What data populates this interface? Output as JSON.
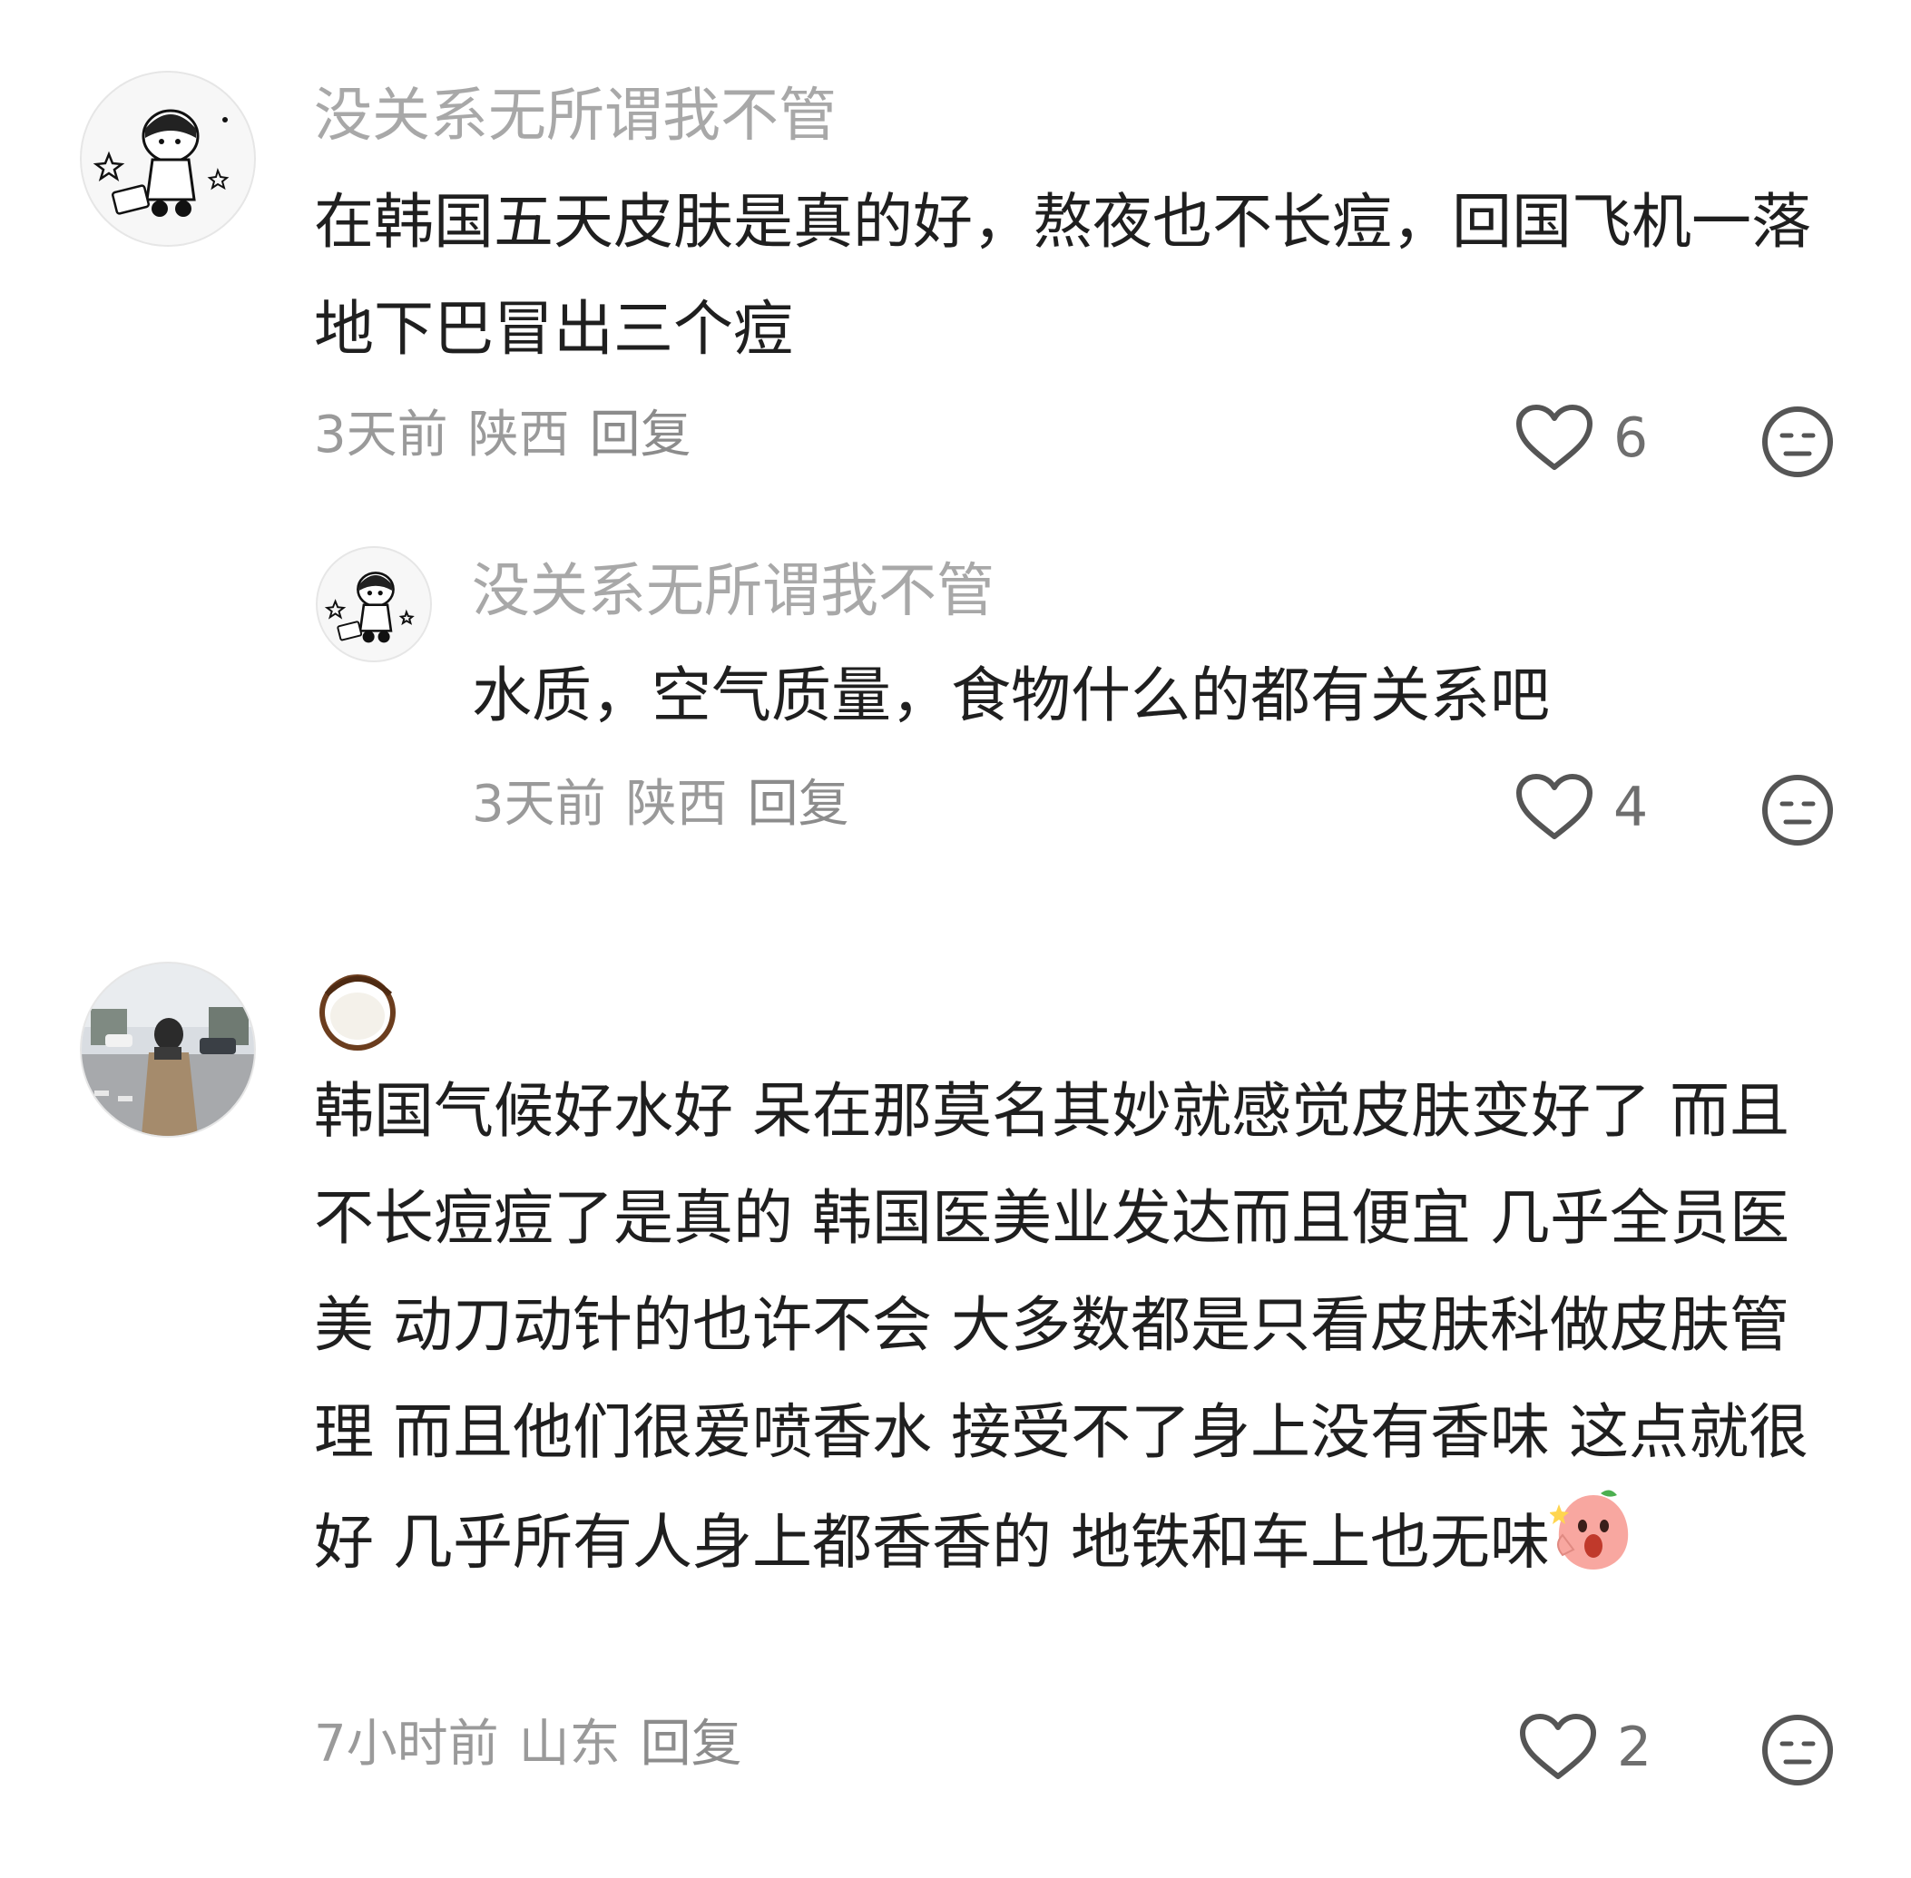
{
  "comments": [
    {
      "username": "没关系无所谓我不管",
      "text": "在韩国五天皮肤是真的好，熬夜也不长痘，回国飞机一落地下巴冒出三个痘",
      "time": "3天前",
      "location": "陕西",
      "reply_label": "回复",
      "likes": "6",
      "avatar_icon": "cartoon-girl-avatar-icon",
      "replies": [
        {
          "username": "没关系无所谓我不管",
          "text": "水质，空气质量，食物什么的都有关系吧",
          "time": "3天前",
          "location": "陕西",
          "reply_label": "回复",
          "likes": "4",
          "avatar_icon": "cartoon-girl-avatar-icon"
        }
      ]
    },
    {
      "username_icon": "coconut-emoji-icon",
      "text": "韩国气候好水好 呆在那莫名其妙就感觉皮肤变好了 而且不长痘痘了是真的 韩国医美业发达而且便宜 几乎全员医美 动刀动针的也许不会 大多数都是只看皮肤科做皮肤管理 而且他们很爱喷香水 接受不了身上没有香味 这点就很好 几乎所有人身上都香香的 地铁和车上也无味",
      "trailing_emoji": "shocked-peach-emoji-icon",
      "time": "7小时前",
      "location": "山东",
      "reply_label": "回复",
      "likes": "2",
      "avatar_icon": "street-photo-avatar-icon"
    }
  ]
}
